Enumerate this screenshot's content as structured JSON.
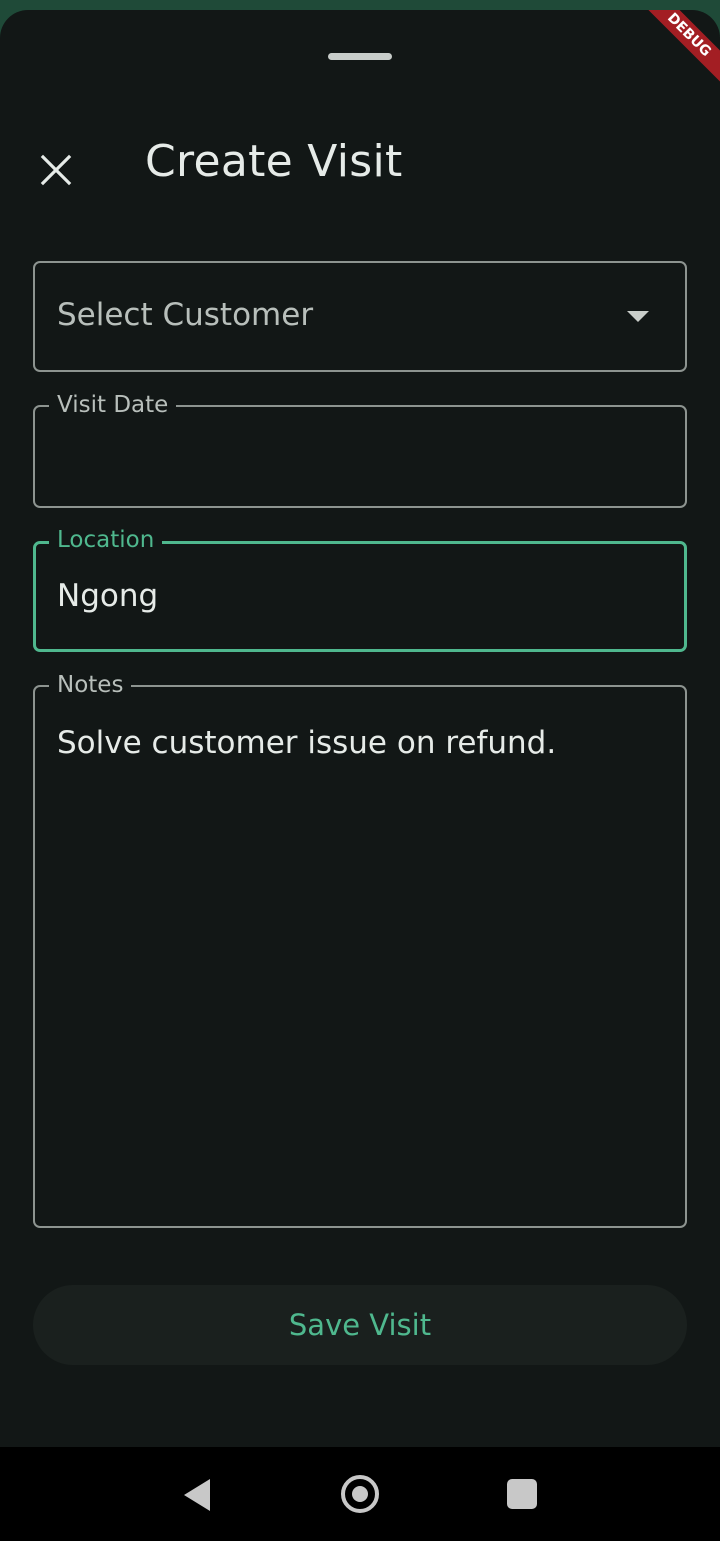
{
  "app": {
    "debug_banner": "DEBUG"
  },
  "header": {
    "title": "Create Visit",
    "close_icon": "close-icon"
  },
  "form": {
    "customer": {
      "placeholder": "Select Customer",
      "icon": "dropdown-arrow-icon"
    },
    "visit_date": {
      "label": "Visit Date",
      "value": ""
    },
    "location": {
      "label": "Location",
      "value": "Ngong",
      "focused": true
    },
    "notes": {
      "label": "Notes",
      "value": "Solve customer issue on refund."
    },
    "save_label": "Save Visit"
  },
  "colors": {
    "accent": "#4fb88e",
    "background": "#121716",
    "outline": "#8d9490"
  },
  "system_nav": {
    "back_icon": "back-triangle-icon",
    "home_icon": "home-circle-icon",
    "recents_icon": "recents-square-icon"
  }
}
